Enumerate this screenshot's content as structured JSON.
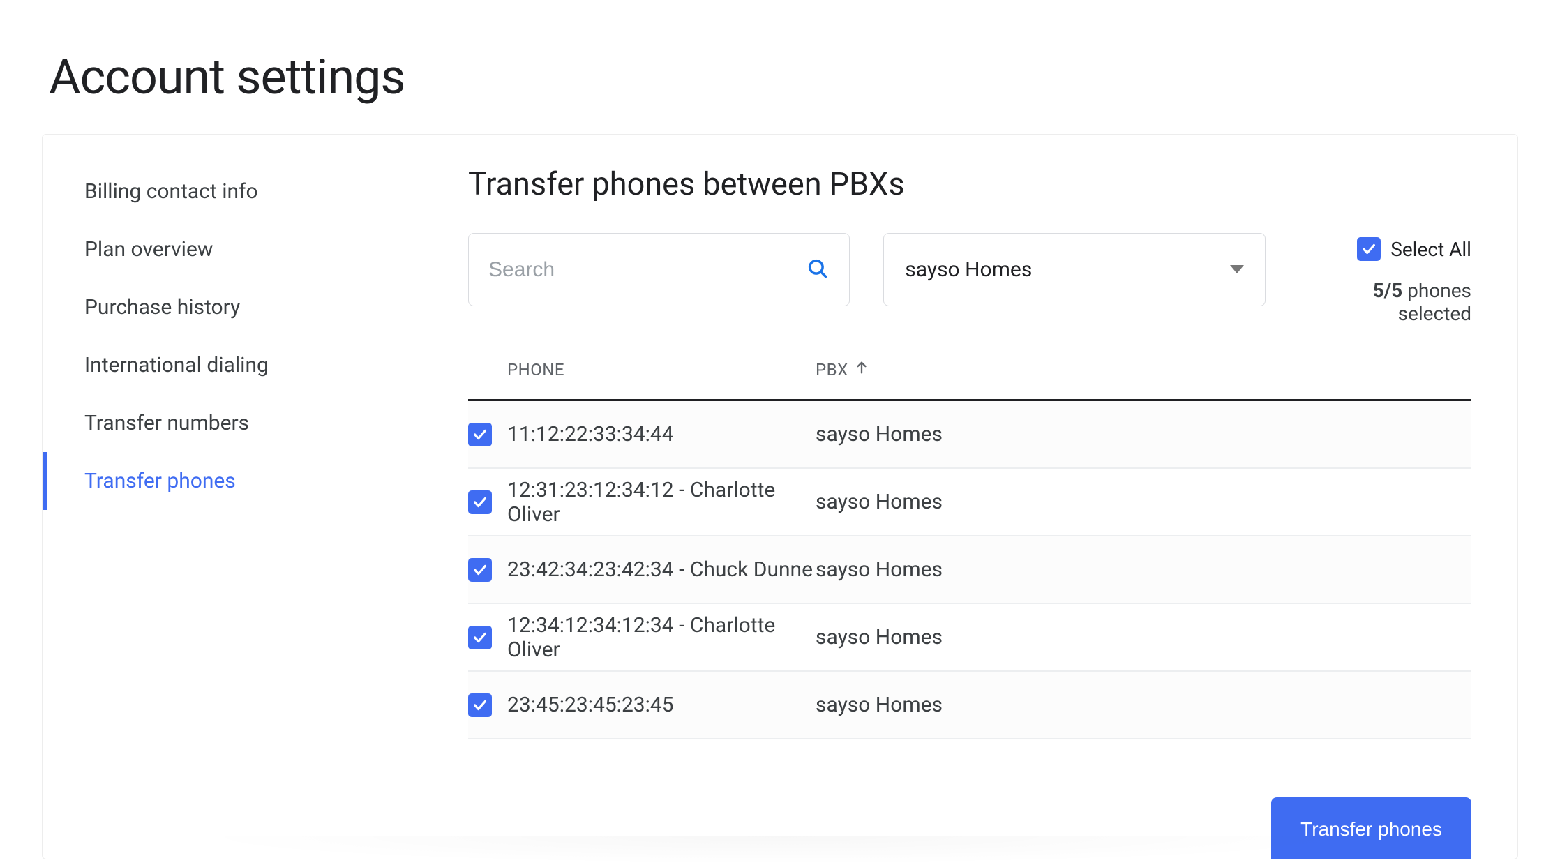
{
  "page": {
    "title": "Account settings"
  },
  "sidebar": {
    "items": [
      {
        "label": "Billing contact info",
        "name": "sidebar-item-billing",
        "active": false
      },
      {
        "label": "Plan overview",
        "name": "sidebar-item-plan",
        "active": false
      },
      {
        "label": "Purchase history",
        "name": "sidebar-item-purchase",
        "active": false
      },
      {
        "label": "International dialing",
        "name": "sidebar-item-international",
        "active": false
      },
      {
        "label": "Transfer numbers",
        "name": "sidebar-item-transfer-numbers",
        "active": false
      },
      {
        "label": "Transfer phones",
        "name": "sidebar-item-transfer-phones",
        "active": true
      }
    ]
  },
  "main": {
    "title": "Transfer phones between PBXs",
    "search": {
      "placeholder": "Search",
      "value": ""
    },
    "pbx_select": {
      "selected": "sayso Homes"
    },
    "select_all": {
      "label": "Select All",
      "checked": true
    },
    "selection_status": {
      "selected": "5/5",
      "suffix": " phones selected"
    },
    "columns": {
      "phone": "PHONE",
      "pbx": "PBX"
    },
    "rows": [
      {
        "phone": "11:12:22:33:34:44",
        "pbx": "sayso Homes",
        "checked": true
      },
      {
        "phone": "12:31:23:12:34:12 - Charlotte Oliver",
        "pbx": "sayso Homes",
        "checked": true
      },
      {
        "phone": "23:42:34:23:42:34 - Chuck Dunne",
        "pbx": "sayso Homes",
        "checked": true
      },
      {
        "phone": "12:34:12:34:12:34 - Charlotte Oliver",
        "pbx": "sayso Homes",
        "checked": true
      },
      {
        "phone": "23:45:23:45:23:45",
        "pbx": "sayso Homes",
        "checked": true
      }
    ],
    "transfer_button": "Transfer phones"
  },
  "icons": {
    "search": "search-icon",
    "dropdown": "dropdown-icon",
    "sort_up": "arrow-up-icon",
    "check": "check-icon"
  },
  "colors": {
    "accent": "#3f6cf2"
  }
}
